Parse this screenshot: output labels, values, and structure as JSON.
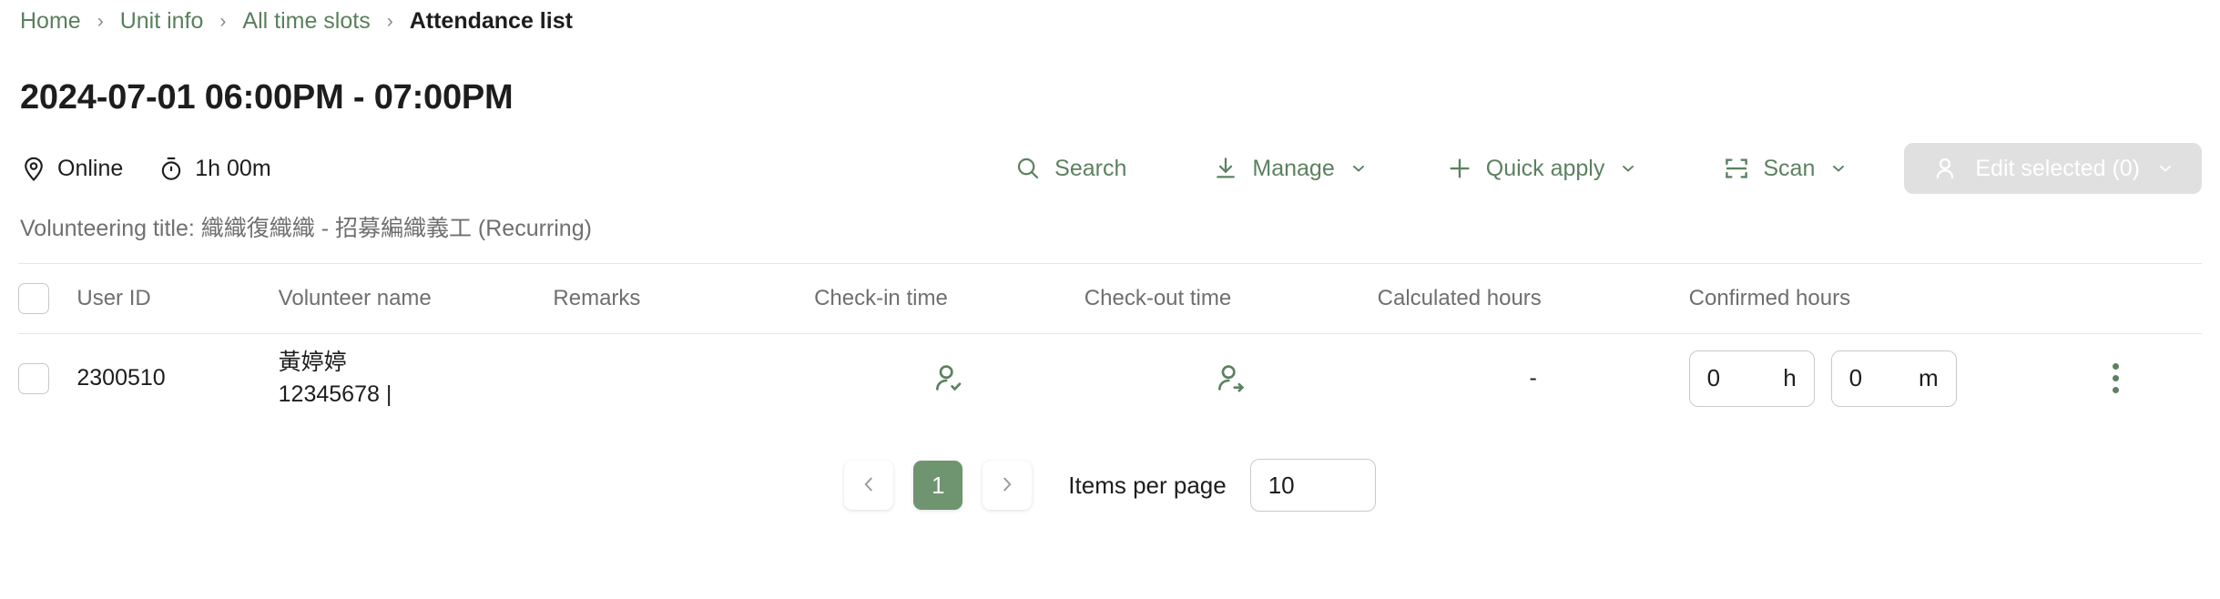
{
  "breadcrumb": {
    "items": [
      {
        "label": "Home",
        "current": false
      },
      {
        "label": "Unit info",
        "current": false
      },
      {
        "label": "All time slots",
        "current": false
      },
      {
        "label": "Attendance list",
        "current": true
      }
    ],
    "separator": "›"
  },
  "page_title": "2024-07-01 06:00PM - 07:00PM",
  "meta": {
    "location_label": "Online",
    "duration_label": "1h 00m",
    "location_icon": "location-pin-icon",
    "duration_icon": "stopwatch-icon"
  },
  "toolbar": {
    "search_label": "Search",
    "manage_label": "Manage",
    "quick_apply_label": "Quick apply",
    "scan_label": "Scan",
    "edit_selected_label": "Edit selected (0)"
  },
  "volunteering_title": "Volunteering title: 織織復織織 - 招募編織義工 (Recurring)",
  "table": {
    "columns": [
      "User ID",
      "Volunteer name",
      "Remarks",
      "Check-in time",
      "Check-out time",
      "Calculated hours",
      "Confirmed hours"
    ],
    "rows": [
      {
        "user_id": "2300510",
        "name": "黃婷婷",
        "phone": "12345678 |",
        "remarks": "",
        "check_in_icon": "user-check-in-icon",
        "check_out_icon": "user-check-out-icon",
        "calculated_hours": "-",
        "confirmed_hours_h": "0",
        "confirmed_hours_h_suffix": "h",
        "confirmed_hours_m": "0",
        "confirmed_hours_m_suffix": "m"
      }
    ]
  },
  "pagination": {
    "prev_icon": "chevron-left-icon",
    "next_icon": "chevron-right-icon",
    "current_page": "1",
    "items_per_page_label": "Items per page",
    "items_per_page_value": "10"
  },
  "colors": {
    "accent_green": "#6f9470",
    "link_green": "#59805c",
    "icon_green": "#5c8160",
    "disabled_gray": "#e0e0e0",
    "muted_text": "#6f6f6f"
  }
}
